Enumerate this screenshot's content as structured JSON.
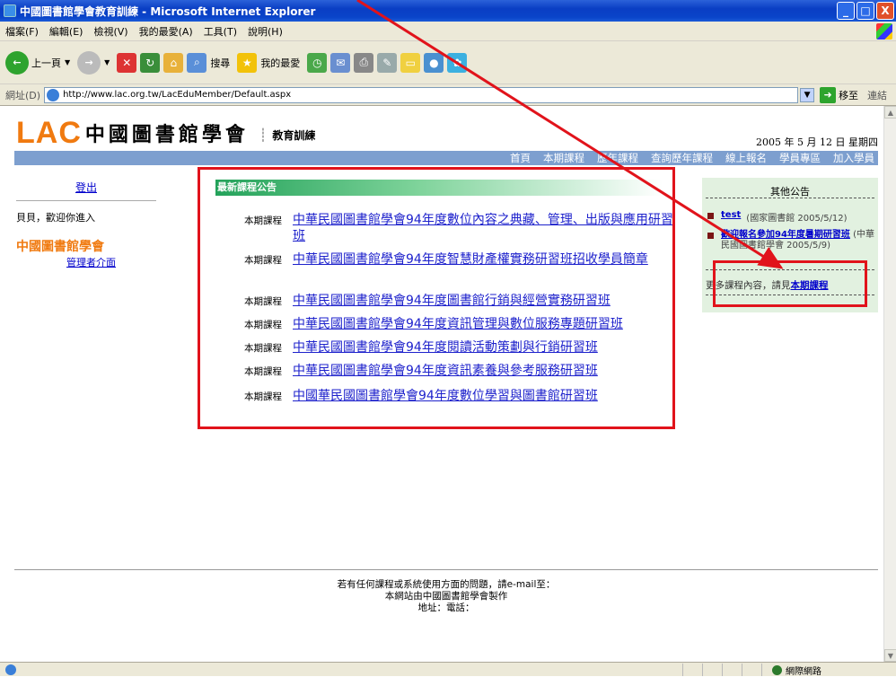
{
  "window": {
    "title": "中國圖書館學會教育訓練 - Microsoft Internet Explorer",
    "min": "_",
    "max": "□",
    "close": "X"
  },
  "menu": [
    "檔案(F)",
    "編輯(E)",
    "檢視(V)",
    "我的最愛(A)",
    "工具(T)",
    "說明(H)"
  ],
  "toolbar": {
    "back_label": "上一頁",
    "search_label": "搜尋",
    "favorites_label": "我的最愛"
  },
  "address": {
    "label": "網址(D)",
    "url": "http://www.lac.org.tw/LacEduMember/Default.aspx",
    "go_label": "移至",
    "links_label": "連結"
  },
  "site": {
    "logo_text": "LAC",
    "org_logo": "中國圖書館學會",
    "section": "教育訓練",
    "date": "2005 年 5 月 12 日 星期四",
    "nav": [
      "首頁",
      "本期課程",
      "歷年課程",
      "查詢歷年課程",
      "線上報名",
      "學員專區",
      "加入學員"
    ]
  },
  "left": {
    "logout": "登出",
    "welcome": "貝貝，歡迎你進入",
    "org": "中國圖書館學會",
    "admin": "管理者介面"
  },
  "main": {
    "header": "最新課程公告",
    "announcements": [
      {
        "tag": "本期課程",
        "title": "中華民國圖書館學會94年度數位內容之典藏、管理、出版與應用研習班"
      },
      {
        "tag": "本期課程",
        "title": "中華民國圖書館學會94年度智慧財產權實務研習班招收學員簡章"
      },
      {
        "tag": "本期課程",
        "title": "中華民國圖書館學會94年度圖書館行銷與經營實務研習班"
      },
      {
        "tag": "本期課程",
        "title": "中華民國圖書館學會94年度資訊管理與數位服務專題研習班"
      },
      {
        "tag": "本期課程",
        "title": "中華民國圖書館學會94年度閱讀活動策劃與行銷研習班"
      },
      {
        "tag": "本期課程",
        "title": "中華民國圖書館學會94年度資訊素養與參考服務研習班"
      },
      {
        "tag": "本期課程",
        "title": "中國華民國圖書館學會94年度數位學習與圖書館研習班"
      }
    ]
  },
  "right": {
    "title": "其他公告",
    "items": [
      {
        "link": "test",
        "source": "(國家圖書館 2005/5/12)"
      },
      {
        "link": "歡迎報名參加94年度暑期研習班",
        "source": "(中華民國圖書館學會 2005/5/9)"
      }
    ],
    "more_prefix": "更多課程內容，請見",
    "more_link": "本期課程"
  },
  "footer": {
    "line1": "若有任何課程或系統使用方面的問題，請e-mail至：",
    "line2": "本網站由中國圖書館學會製作",
    "line3": "地址：電話："
  },
  "status": {
    "zone": "網際網路"
  },
  "colors": {
    "accent_orange": "#f07a10",
    "nav_blue": "#7d9fcf",
    "link_blue": "#1e22cc",
    "highlight_red": "#e1131b",
    "panel_green": "#e2f1e0"
  }
}
